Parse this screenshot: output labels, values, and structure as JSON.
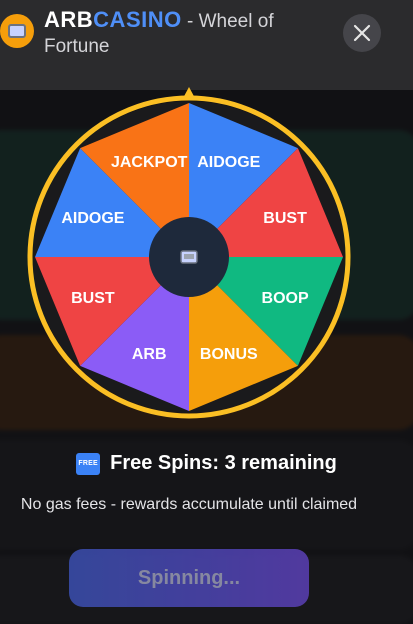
{
  "header": {
    "brand_part1": "ARB",
    "brand_part2": "CASINO",
    "subtitle_part1": " - Wheel of",
    "subtitle_part2": "Fortune"
  },
  "wheel": {
    "segments": [
      {
        "label": "AIDOGE",
        "color": "#3b82f6"
      },
      {
        "label": "BUST",
        "color": "#ef4444"
      },
      {
        "label": "BOOP",
        "color": "#10b981"
      },
      {
        "label": "BONUS",
        "color": "#f59e0b"
      },
      {
        "label": "ARB",
        "color": "#8b5cf6"
      },
      {
        "label": "BUST",
        "color": "#ef4444"
      },
      {
        "label": "AIDOGE",
        "color": "#3b82f6"
      },
      {
        "label": "JACKPOT",
        "color": "#f97316"
      }
    ],
    "rim_color": "#fbbf24",
    "hub_color": "#1e293b"
  },
  "free_spins": {
    "badge": "FREE",
    "text": "Free Spins: 3 remaining"
  },
  "note": "No gas fees - rewards accumulate until claimed",
  "spin_button": "Spinning..."
}
